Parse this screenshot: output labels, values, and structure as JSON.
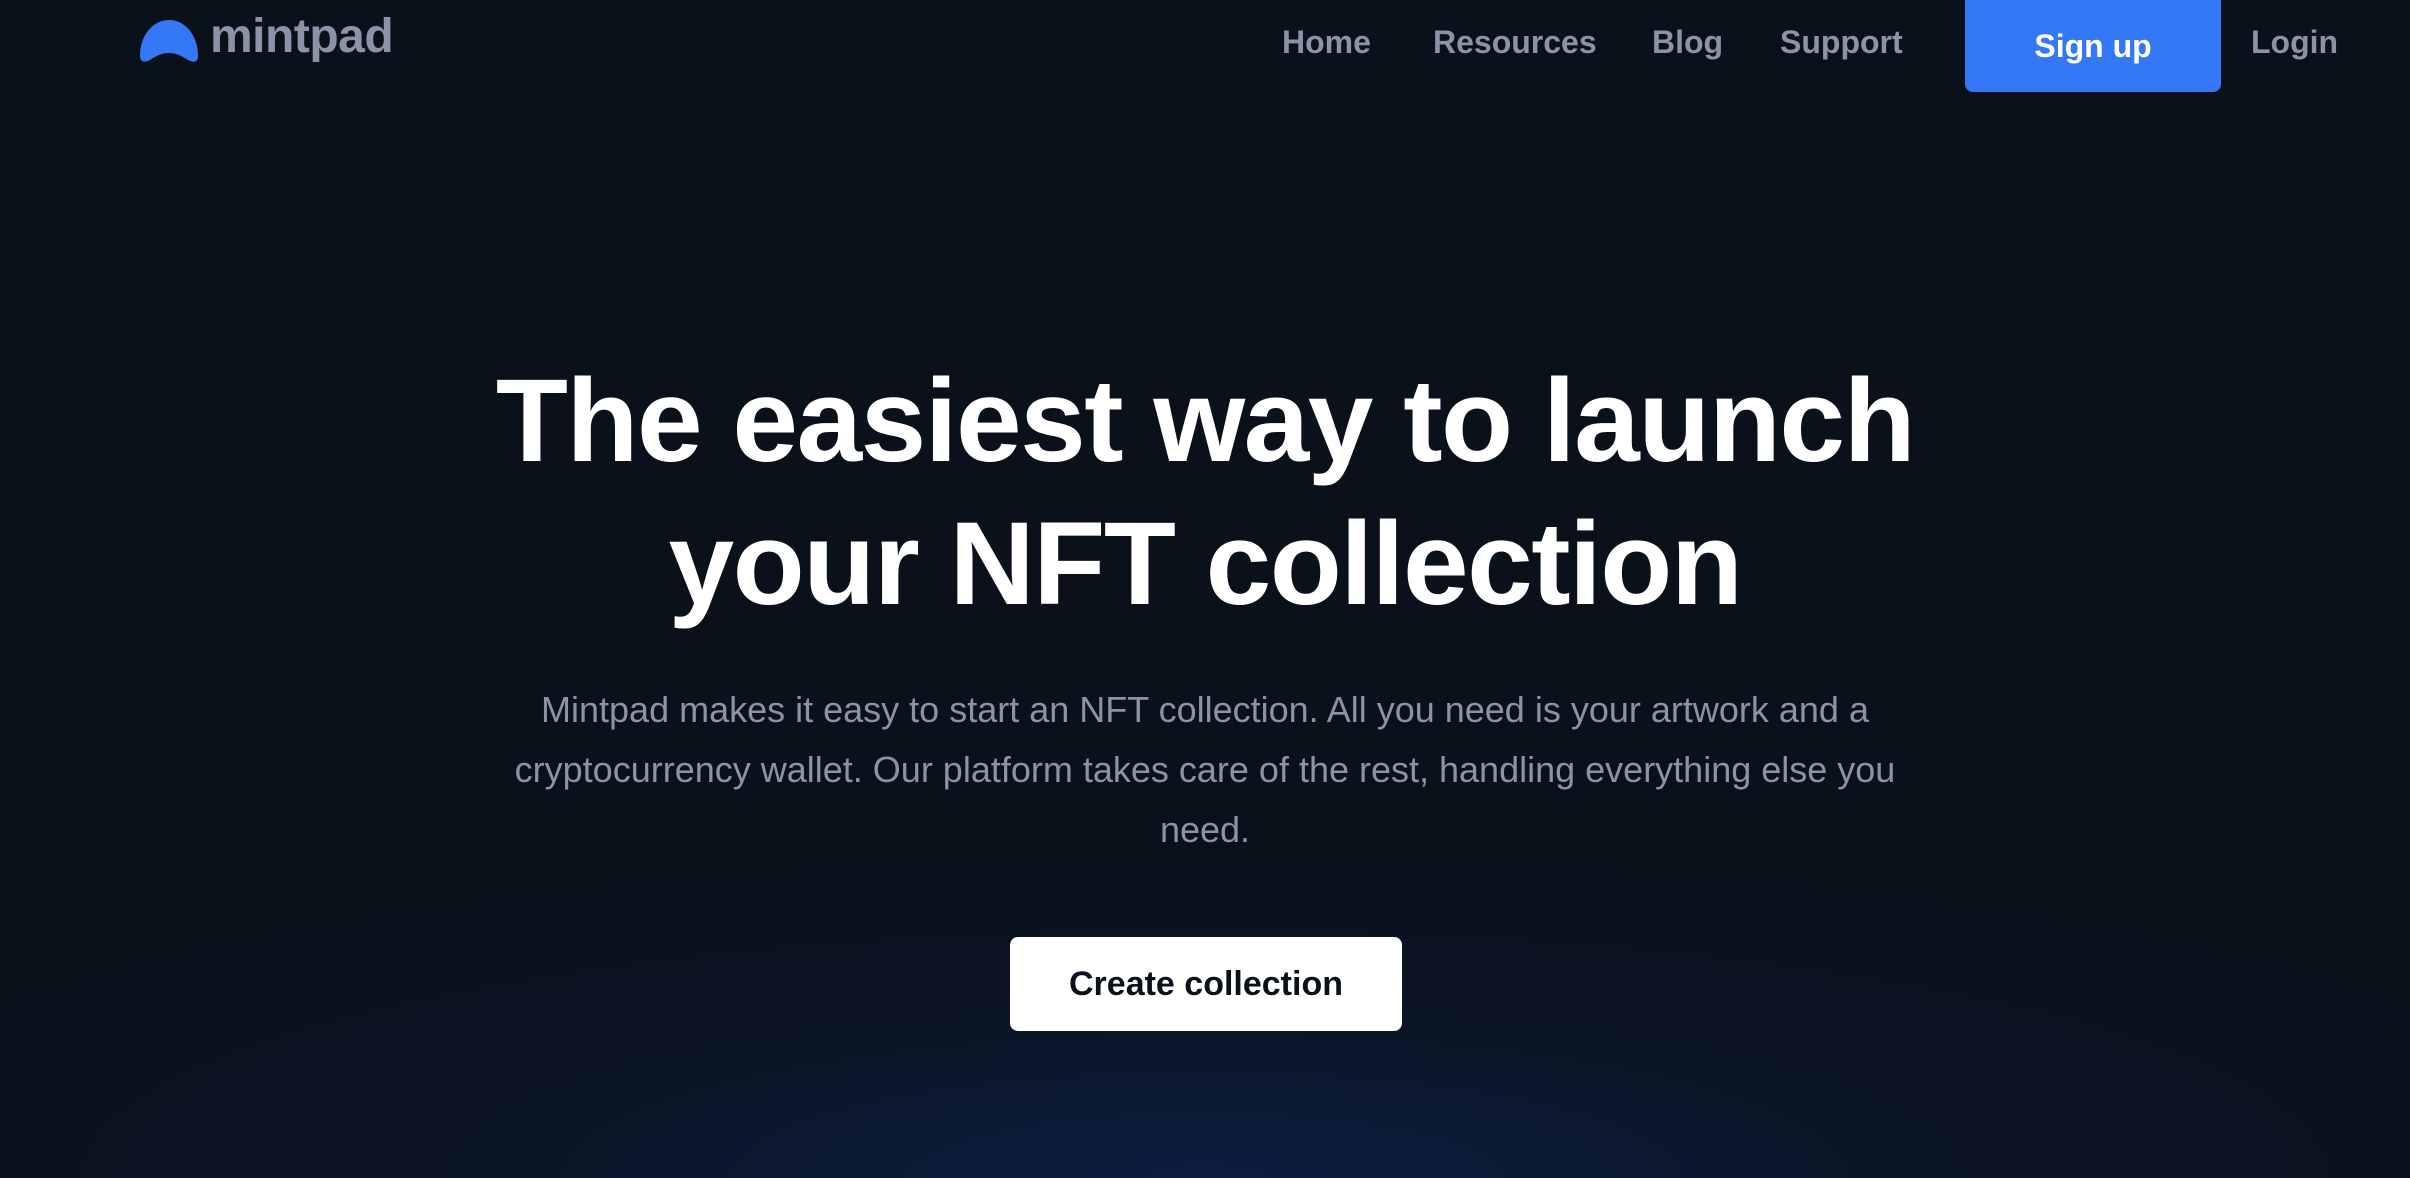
{
  "brand": {
    "name": "mintpad",
    "logo_icon": "mintpad-logo-icon",
    "accent_color": "#3478f6"
  },
  "nav": {
    "links": [
      {
        "label": "Home"
      },
      {
        "label": "Resources"
      },
      {
        "label": "Blog"
      },
      {
        "label": "Support"
      }
    ],
    "signup_label": "Sign up",
    "login_label": "Login"
  },
  "hero": {
    "title_line1": "The easiest way to launch",
    "title_line2": "your NFT collection",
    "description": "Mintpad makes it easy to start an NFT collection. All you need is your artwork and a cryptocurrency wallet. Our platform takes care of the rest, handling everything else you need.",
    "cta_label": "Create collection"
  },
  "colors": {
    "background": "#0a111b",
    "muted_text": "#8a94a6",
    "heading_text": "#ffffff",
    "cta_background": "#ffffff"
  }
}
